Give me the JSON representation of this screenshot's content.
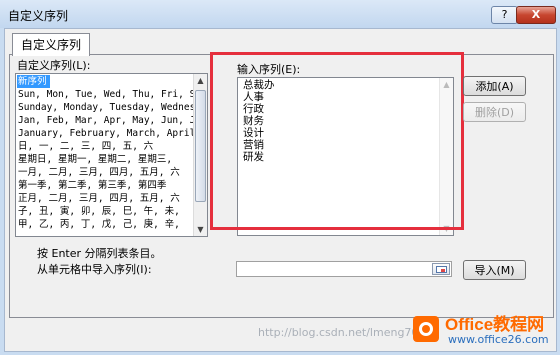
{
  "window": {
    "title": "自定义序列",
    "help_label": "?",
    "close_label": "X"
  },
  "tabs": [
    {
      "label": "自定义序列"
    }
  ],
  "left_panel": {
    "label": "自定义序列(L):",
    "items": [
      "新序列",
      "Sun, Mon, Tue, Wed, Thu, Fri, S",
      "Sunday, Monday, Tuesday, Wednes",
      "Jan, Feb, Mar, Apr, May, Jun, Ju",
      "January, February, March, April,",
      "日, 一, 二, 三, 四, 五, 六",
      "星期日, 星期一, 星期二, 星期三,",
      "一月, 二月, 三月, 四月, 五月, 六",
      "第一季, 第二季, 第三季, 第四季",
      "正月, 二月, 三月, 四月, 五月, 六",
      "子, 丑, 寅, 卯, 辰, 巳, 午, 未,",
      "甲, 乙, 丙, 丁, 戊, 己, 庚, 辛,"
    ],
    "selected_index": 0
  },
  "right_panel": {
    "label": "输入序列(E):",
    "entries": [
      "总裁办",
      "人事",
      "行政",
      "财务",
      "设计",
      "营销",
      "研发"
    ]
  },
  "buttons": {
    "add": "添加(A)",
    "delete": "删除(D)",
    "import": "导入(M)"
  },
  "hint": "按 Enter 分隔列表条目。",
  "import_label": "从单元格中导入序列(I):",
  "import_value": "",
  "watermark": "http://blog.csdn.net/lmeng7070",
  "logo": {
    "text": "Office教程网",
    "sub": "www.office26.com"
  },
  "colors": {
    "highlight": "#e52f3d",
    "selection": "#3399ff",
    "logo_orange": "#ff6a00"
  }
}
